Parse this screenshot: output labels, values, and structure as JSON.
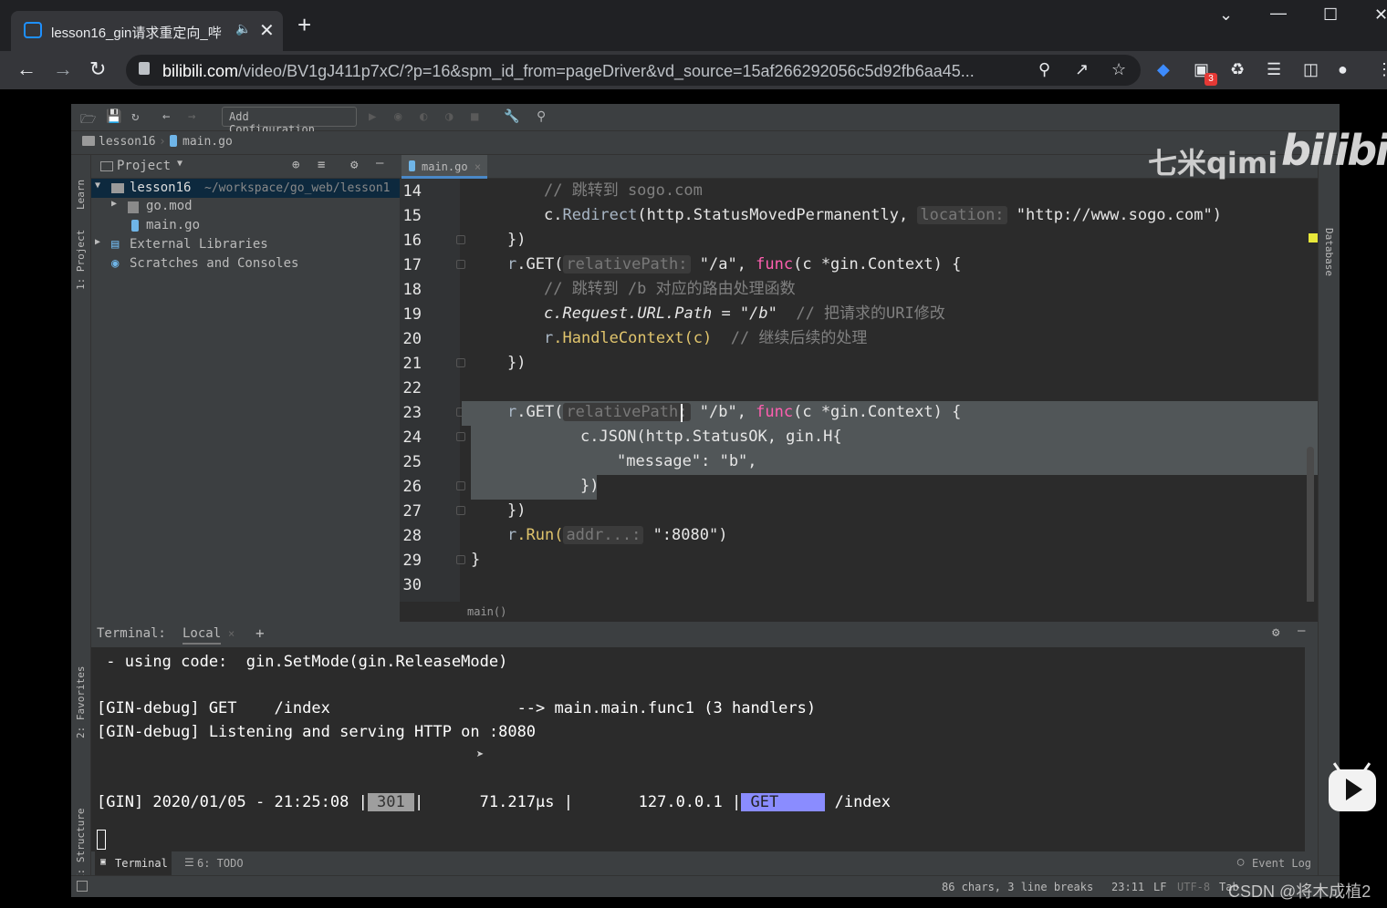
{
  "browser": {
    "tab_title": "lesson16_gin请求重定向_哔",
    "new_tab": "+",
    "url_host": "bilibili.com",
    "url_path": "/video/BV1gJ411p7xC/?p=16&spm_id_from=pageDriver&vd_source=15af266292056c5d92fb6aa45...",
    "ext_badge": "3"
  },
  "ide": {
    "toolbar": {
      "add_configuration": "Add Configuration..."
    },
    "breadcrumb": {
      "project": "lesson16",
      "file": "main.go"
    },
    "left_strip": {
      "learn": "Learn",
      "project": "1: Project",
      "favorites": "2: Favorites",
      "structure": "Z: Structure"
    },
    "right_strip": {
      "database": "Database"
    },
    "project_panel": {
      "title": "Project",
      "tree": [
        {
          "label": "lesson16",
          "path": "~/workspace/go_web/lesson1"
        },
        {
          "label": "go.mod"
        },
        {
          "label": "main.go"
        },
        {
          "label": "External Libraries"
        },
        {
          "label": "Scratches and Consoles"
        }
      ]
    },
    "editor": {
      "tab": "main.go",
      "line_numbers": [
        "14",
        "15",
        "16",
        "17",
        "18",
        "19",
        "20",
        "21",
        "22",
        "23",
        "24",
        "25",
        "26",
        "27",
        "28",
        "29",
        "30"
      ],
      "lines": {
        "l14_comment": "// 跳转到 sogo.com",
        "l15_a": "c.",
        "l15_b": "Redirect",
        "l15_c": "(http.StatusMovedPermanently, ",
        "l15_hint": "location:",
        "l15_d": " \"http://www.sogo.com\")",
        "l16": "})",
        "l17_r": "r",
        "l17_get": ".GET(",
        "l17_hint": "relativePath:",
        "l17_str": " \"/a\", ",
        "l17_func": "func",
        "l17_rest": "(c *gin.Context) {",
        "l18_comment": "// 跳转到 /b 对应的路由处理函数",
        "l19_code": "c.Request.URL.Path = \"/b\"",
        "l19_comment": "  // 把请求的URI修改",
        "l20_r": "r",
        "l20_code": ".HandleContext(c)",
        "l20_comment": "  // 继续后续的处理",
        "l21": "})",
        "l23_r": "r",
        "l23_get": ".GET(",
        "l23_hint": "relativePath:",
        "l23_str": " \"/b\", ",
        "l23_func": "func",
        "l23_rest": "(c *gin.Context) {",
        "l24": "c.JSON(http.StatusOK, gin.H{",
        "l25": "\"message\": \"b\",",
        "l26": "})",
        "l27": "})",
        "l28_r": "r",
        "l28_run": ".Run(",
        "l28_hint": "addr...:",
        "l28_rest": " \":8080\")",
        "l29": "}"
      },
      "footer": "main()"
    },
    "terminal": {
      "label": "Terminal:",
      "tab": "Local",
      "add": "+",
      "lines": {
        "t1": " - using code:  gin.SetMode(gin.ReleaseMode)",
        "t2": "[GIN-debug] GET    /index                    --> main.main.func1 (3 handlers)",
        "t3": "[GIN-debug] Listening and serving HTTP on :8080",
        "t4_a": "[GIN] 2020/01/05 - 21:25:08 |",
        "t4_status": " 301 ",
        "t4_b": "|      71.217µs |       127.0.0.1 |",
        "t4_method": " GET     ",
        "t4_c": " /index"
      }
    },
    "bottom_tabs": {
      "terminal": "Terminal",
      "todo": "6: TODO",
      "event_log": "Event Log"
    },
    "status_bar": {
      "selection": "86 chars, 3 line breaks",
      "position": "23:11",
      "line_sep": "LF",
      "encoding": "UTF-8",
      "tab": "Tab"
    }
  },
  "watermarks": {
    "uploader": "七米qimi",
    "site": "bilibili",
    "csdn": "CSDN @将木成植2"
  }
}
